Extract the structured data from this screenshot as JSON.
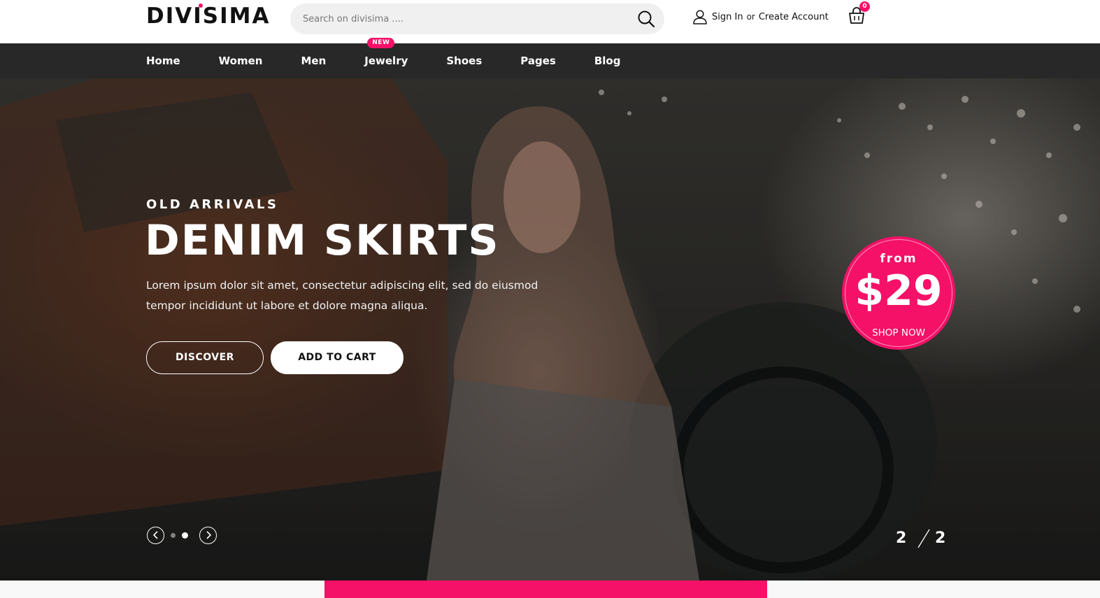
{
  "brand": {
    "name": "DIVISIMA",
    "accent": "#f51167",
    "dark": "#282828"
  },
  "search": {
    "placeholder": "Search on divisima ....",
    "icon": "search-icon"
  },
  "account": {
    "sign_in": "Sign In",
    "or": "or",
    "create": "Create Account",
    "icon": "user-icon"
  },
  "cart": {
    "count": "0",
    "icon": "shopping-bag-icon"
  },
  "nav": {
    "items": [
      {
        "label": "Home"
      },
      {
        "label": "Women"
      },
      {
        "label": "Men"
      },
      {
        "label": "Jewelry",
        "badge": "NEW"
      },
      {
        "label": "Shoes"
      },
      {
        "label": "Pages"
      },
      {
        "label": "Blog"
      }
    ]
  },
  "hero": {
    "subtitle": "OLD ARRIVALS",
    "title": "DENIM SKIRTS",
    "text": "Lorem ipsum dolor sit amet, consectetur adipiscing elit, sed do eiusmod tempor incididunt ut labore et dolore magna aliqua.",
    "discover_label": "DISCOVER",
    "add_to_cart_label": "ADD TO CART",
    "price_from": "from",
    "price": "$29",
    "shop_now": "SHOP NOW",
    "slide_current": "2",
    "slide_total": "2"
  }
}
